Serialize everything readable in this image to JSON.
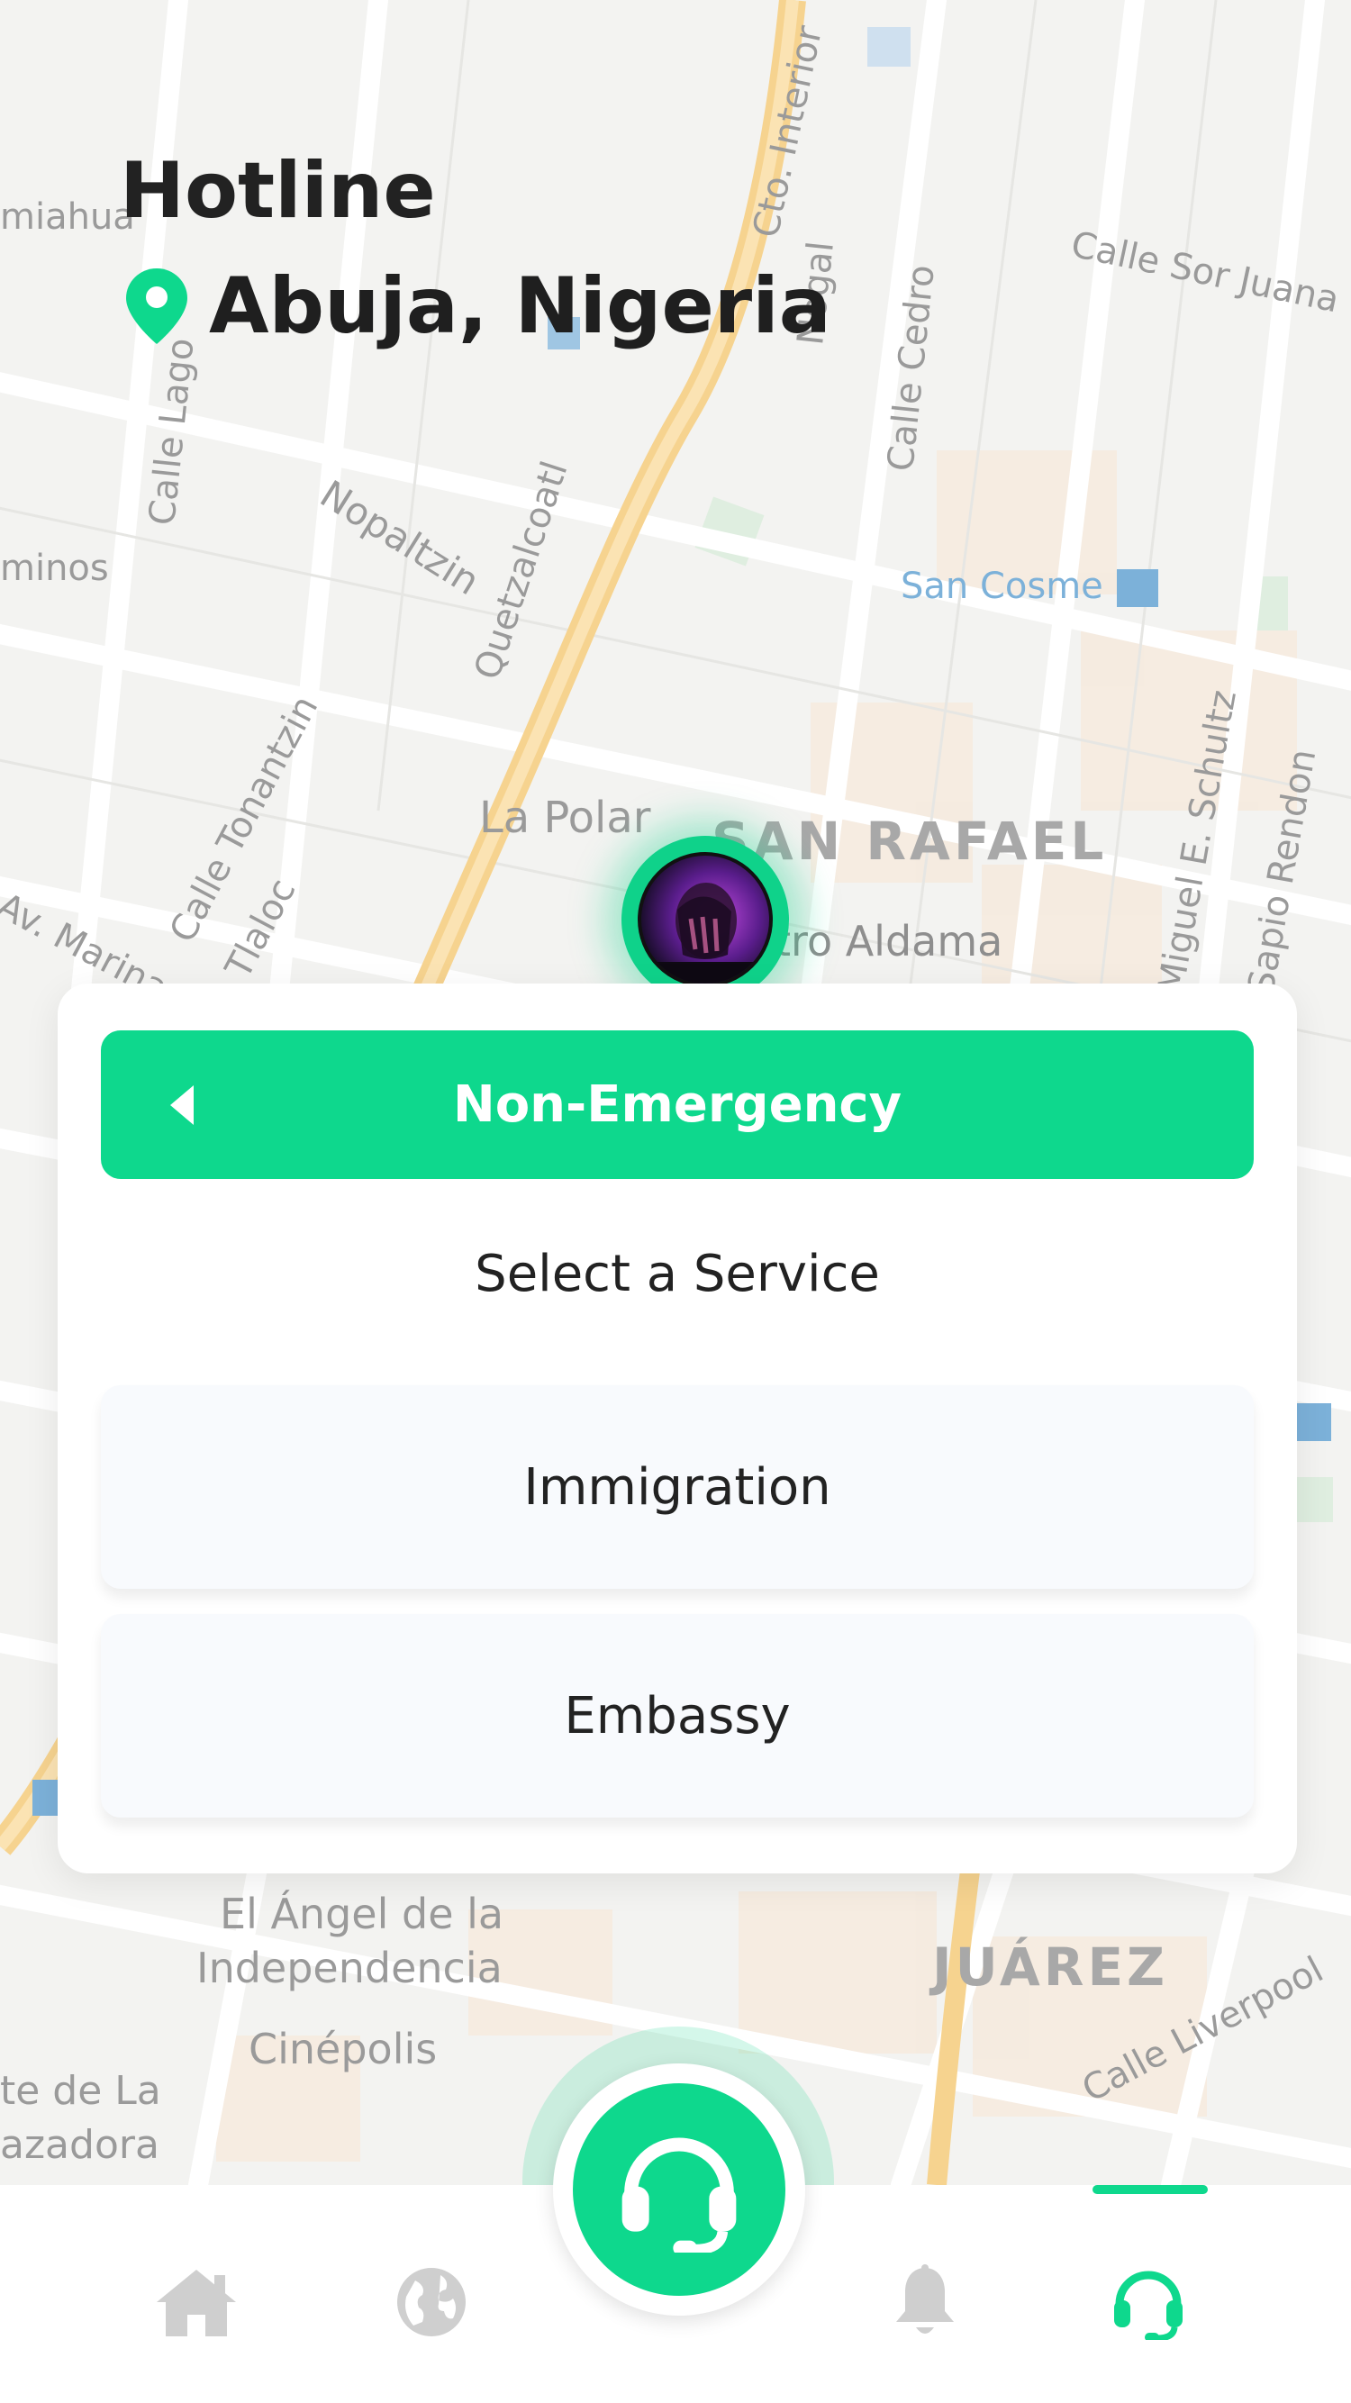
{
  "header": {
    "title": "Hotline",
    "location": "Abuja, Nigeria"
  },
  "map": {
    "labels": {
      "san_rafael": "SAN RAFAEL",
      "juarez": "JUÁREZ",
      "la_polar": "La Polar",
      "san_cosme": "San Cosme",
      "aldama": "tro Aldama",
      "angel_1": "El Ángel de la",
      "angel_2": "Independencia",
      "cinepolis": "Cinépolis",
      "nopaltzin": "Nopaltzin",
      "quetzalcoatl": "Quetzalcoatl",
      "calle_tonantzin": "Calle Tonantzin",
      "tlaloc": "Tlaloc",
      "calle_sor_juana": "Calle Sor Juana",
      "calle_cedro": "Calle Cedro",
      "nogal": "Nogal",
      "cto_interior": "Cto. Interior",
      "calle_lago": "Calle Lago",
      "miguel_schultz": "Miguel E. Schultz",
      "sapio_rendon": "Sapio Rendon",
      "av_marina": "Av. Marina",
      "calle_liverpool": "Calle Liverpool",
      "minos": "minos",
      "miahua": "miahua",
      "te_de_la": "te de La",
      "azadora": "azadora"
    }
  },
  "card": {
    "category": "Non-Emergency",
    "heading": "Select a Service",
    "services": [
      {
        "label": "Immigration"
      },
      {
        "label": "Embassy"
      }
    ]
  },
  "nav": {
    "items": [
      {
        "icon": "home-icon"
      },
      {
        "icon": "globe-icon"
      },
      {
        "icon": "headset-icon"
      },
      {
        "icon": "bell-icon"
      },
      {
        "icon": "headset-icon"
      }
    ],
    "active_index": 4
  },
  "colors": {
    "accent": "#0ed88d",
    "nav_inactive": "#cfcfcf",
    "map_bg": "#f3f3f1"
  }
}
